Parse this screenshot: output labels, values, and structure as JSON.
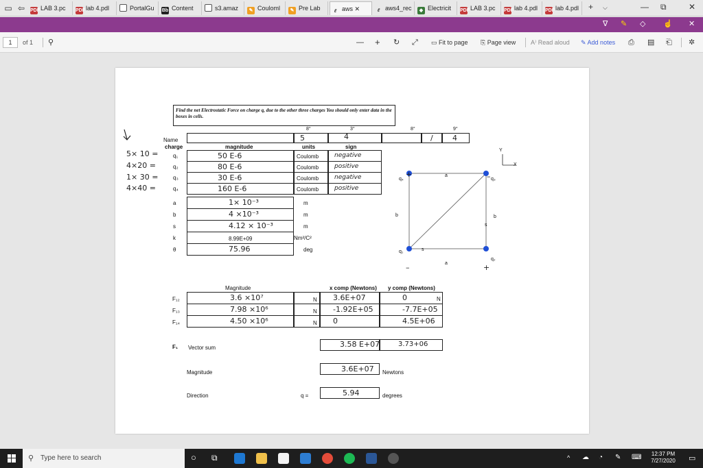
{
  "browser": {
    "tabs": [
      {
        "label": "LAB 3.pc",
        "icon": "pdf-icon"
      },
      {
        "label": "lab 4.pdl",
        "icon": "pdf-icon"
      },
      {
        "label": "PortalGu",
        "icon": "page-icon"
      },
      {
        "label": "Content",
        "icon": "blackboard-icon"
      },
      {
        "label": "s3.amaz",
        "icon": "page-icon"
      },
      {
        "label": "Couloml",
        "icon": "pencil-icon"
      },
      {
        "label": "Pre Lab",
        "icon": "pencil-icon"
      },
      {
        "label": "aws",
        "icon": "aws-icon"
      },
      {
        "label": "aws4_rec",
        "icon": "aws-icon"
      },
      {
        "label": "Electricit",
        "icon": "sim-icon"
      },
      {
        "label": "LAB 3.pc",
        "icon": "pdf-icon"
      },
      {
        "label": "lab 4.pdl",
        "icon": "pdf-icon"
      },
      {
        "label": "lab 4.pdl",
        "icon": "pdf-icon"
      }
    ],
    "new_tab_label": "+",
    "minimize_label": "—",
    "restore_label": "⧉",
    "close_label": "✕"
  },
  "pdf_toolbar": {
    "page_number": "1",
    "page_count": "of 1",
    "zoom_out": "—",
    "zoom_in": "+",
    "fit_to_page": "Fit to page",
    "page_view": "Page view",
    "read_aloud": "Read aloud",
    "add_notes": "Add notes"
  },
  "worksheet": {
    "instructions": "Find the net Electrostatic Force on charge q, due to the other three charges You should only enter data in the boxes in cells.",
    "name_label": "Name",
    "charge_header": "charge",
    "magnitude_header": "magnitude",
    "units_header": "units",
    "sign_header": "sign",
    "name_boxes": [
      "5",
      "4",
      "",
      "/",
      "4"
    ],
    "small_marks": [
      "8°",
      "3°",
      "8°",
      "9°"
    ],
    "margin_notes": [
      "5× 10 =",
      "4×20 =",
      "1× 30 =",
      "4×40 ="
    ],
    "charges": [
      {
        "label": "q₁",
        "magnitude": "50 E-6",
        "unit": "Coulomb",
        "sign": "negative"
      },
      {
        "label": "q₂",
        "magnitude": "80 E-6",
        "unit": "Coulomb",
        "sign": "positive"
      },
      {
        "label": "q₃",
        "magnitude": "30 E-6",
        "unit": "Coulomb",
        "sign": "negative"
      },
      {
        "label": "q₄",
        "magnitude": "160 E-6",
        "unit": "Coulomb",
        "sign": "positive"
      }
    ],
    "params": [
      {
        "label": "a",
        "value": "1× 10⁻³",
        "unit": "m"
      },
      {
        "label": "b",
        "value": "4 ×10⁻³",
        "unit": "m"
      },
      {
        "label": "s",
        "value": "4.12 × 10⁻³",
        "unit": "m"
      },
      {
        "label": "k",
        "value": "8.99E+09",
        "unit": "Nm²/C²"
      },
      {
        "label": "θ",
        "value": "75.96",
        "unit": "deg"
      }
    ],
    "forces_header": {
      "magnitude": "Magnitude",
      "x": "x comp (Newtons)",
      "y": "y comp (Newtons)"
    },
    "forces": [
      {
        "label": "F₁₂",
        "magnitude": "3.6 ×10⁷",
        "unit": "N",
        "x": "3.6E+07",
        "y": "0",
        "y_unit": "N"
      },
      {
        "label": "F₁₃",
        "magnitude": "7.98 ×10⁶",
        "unit": "N",
        "x": "-1.92E+05",
        "y": "-7.7E+05"
      },
      {
        "label": "F₁₄",
        "magnitude": "4.50 ×10⁶",
        "unit": "N",
        "x": "0",
        "y": "4.5E+06"
      }
    ],
    "vector_sum": {
      "label": "F₁",
      "text": "Vector sum",
      "x": "3.58 E+07",
      "y": "3.73+06"
    },
    "magnitude": {
      "label": "Magnitude",
      "value": "3.6E+07",
      "unit": "Newtons"
    },
    "direction": {
      "label": "Direction",
      "symbol": "q =",
      "value": "5.94",
      "unit": "degrees"
    },
    "diagram": {
      "axis_y": "Y",
      "axis_x": "X",
      "q_labels": [
        "q₄",
        "q₃",
        "q₁",
        "q₂"
      ],
      "side_labels": [
        "a",
        "b",
        "b",
        "s",
        "s",
        "a"
      ],
      "signs": [
        "+",
        "–",
        "–",
        "+"
      ]
    }
  },
  "taskbar": {
    "search_placeholder": "Type here to search",
    "time": "12:37 PM",
    "date": "7/27/2020"
  }
}
